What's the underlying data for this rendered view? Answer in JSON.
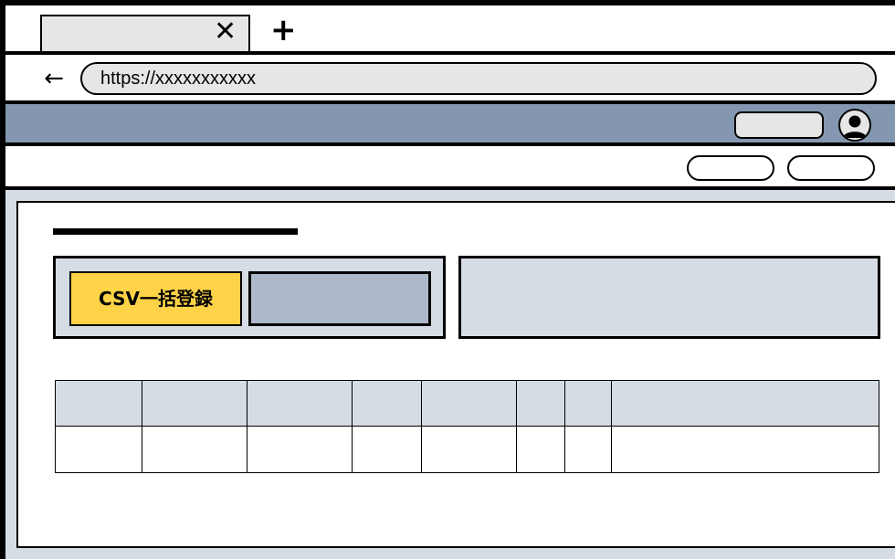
{
  "browser": {
    "tab": {
      "title": "",
      "close_icon": "✕"
    },
    "new_tab_icon": "+",
    "back_icon": "←",
    "url": "https://xxxxxxxxxxx"
  },
  "header": {
    "button_label": "",
    "avatar_icon": "user-avatar-icon"
  },
  "subheader": {
    "buttons": [
      "",
      ""
    ]
  },
  "main": {
    "page_title": "",
    "csv_import_button": "CSV一括登録",
    "secondary_button": "",
    "info_panel_text": ""
  },
  "table": {
    "columns": [
      "",
      "",
      "",
      "",
      "",
      "",
      "",
      ""
    ],
    "rows": [
      [
        "",
        "",
        "",
        "",
        "",
        "",
        "",
        ""
      ]
    ]
  },
  "colors": {
    "header_bg": "#8497b0",
    "content_bg": "#d6dce4",
    "csv_button": "#ffd347",
    "secondary_button": "#adb9ca"
  }
}
